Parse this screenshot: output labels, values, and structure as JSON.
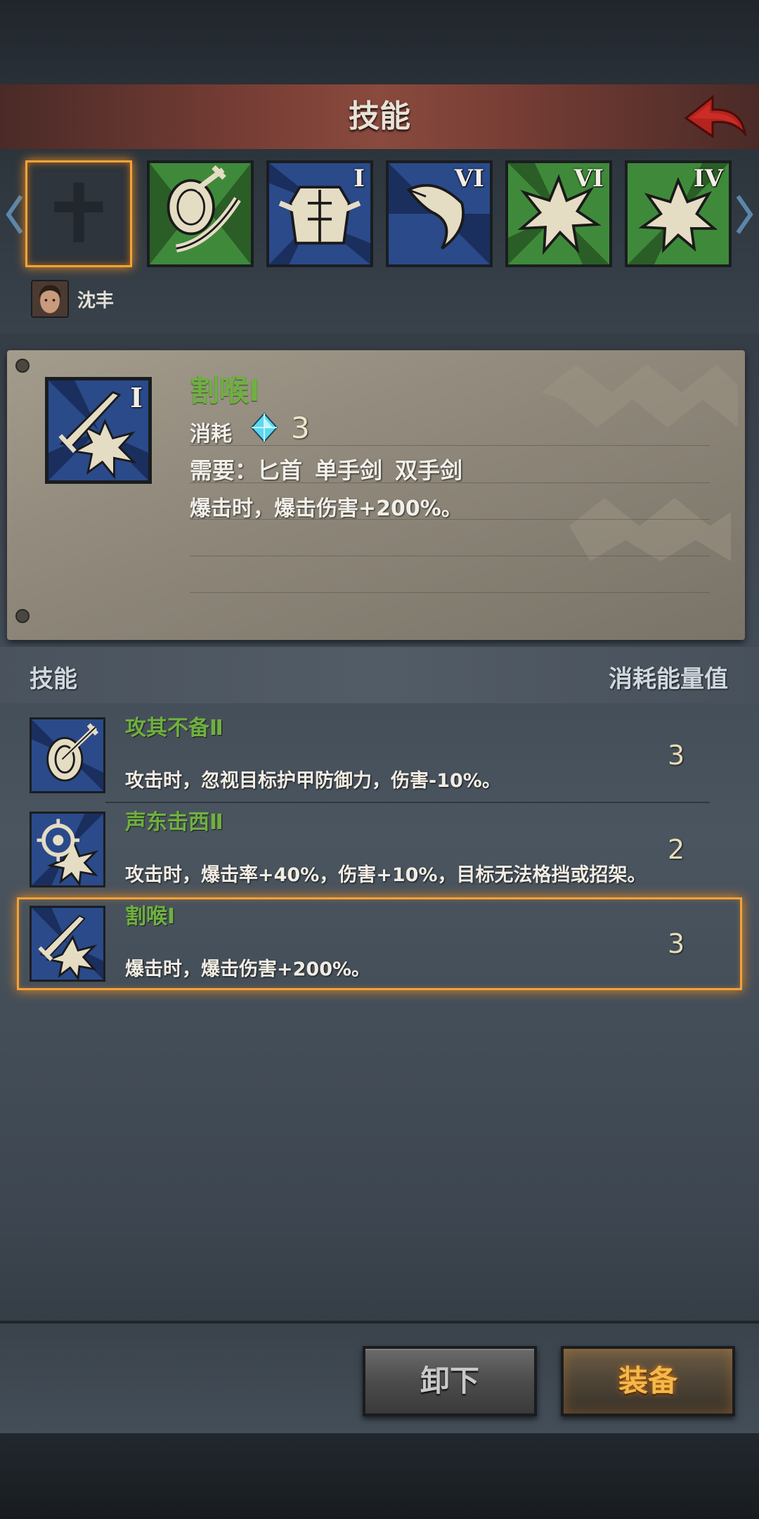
{
  "header": {
    "title": "技能"
  },
  "equipped_slots": [
    {
      "name": "empty-slot",
      "roman": "",
      "bg": "#2e353c"
    },
    {
      "name": "shield-sword",
      "roman": "",
      "bg": "#3f8a3a"
    },
    {
      "name": "armor",
      "roman": "I",
      "bg": "#2a4a8a"
    },
    {
      "name": "beast-claw",
      "roman": "VI",
      "bg": "#2a4a8a"
    },
    {
      "name": "burst",
      "roman": "VI",
      "bg": "#3f8a3a"
    },
    {
      "name": "burst",
      "roman": "IV",
      "bg": "#3f8a3a"
    }
  ],
  "character": {
    "name": "沈丰"
  },
  "detail": {
    "name": "割喉Ⅰ",
    "cost_label": "消耗",
    "cost_value": "3",
    "requirement_label": "需要：",
    "requirements": [
      "匕首",
      "单手剑",
      "双手剑"
    ],
    "description": "爆击时，爆击伤害+200%。",
    "roman": "I"
  },
  "list_header": {
    "left": "技能",
    "right": "消耗能量值"
  },
  "skills": [
    {
      "name": "攻其不备Ⅱ",
      "description": "攻击时，忽视目标护甲防御力，伤害-10%。",
      "cost": "3",
      "icon": "shield-sword"
    },
    {
      "name": "声东击西Ⅱ",
      "description": "攻击时，爆击率+40%，伤害+10%，目标无法格挡或招架。",
      "cost": "2",
      "icon": "crosshair-burst"
    },
    {
      "name": "割喉Ⅰ",
      "description": "爆击时，爆击伤害+200%。",
      "cost": "3",
      "icon": "dagger-burst"
    }
  ],
  "buttons": {
    "unequip": "卸下",
    "equip": "装备"
  },
  "colors": {
    "accent_orange": "#f2a23a",
    "skill_green": "#6fb040",
    "header_red": "#8a4a3e"
  }
}
